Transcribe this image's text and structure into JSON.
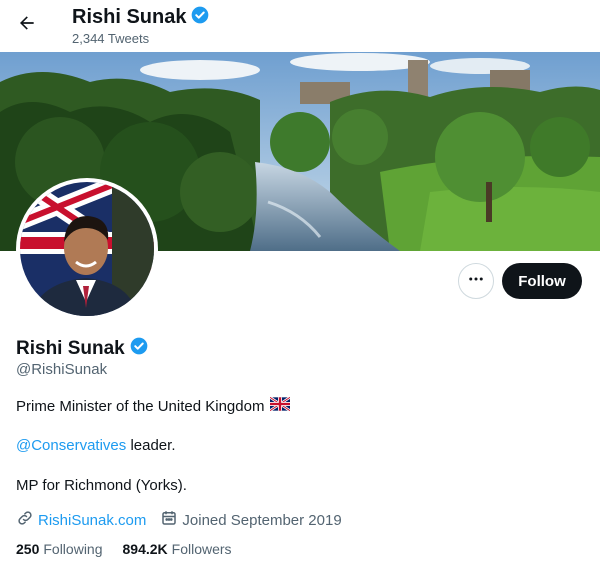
{
  "header": {
    "name": "Rishi Sunak",
    "tweet_count": "2,344 Tweets"
  },
  "actions": {
    "follow_label": "Follow"
  },
  "profile": {
    "name": "Rishi Sunak",
    "handle": "@RishiSunak",
    "bio_line1": "Prime Minister of the United Kingdom",
    "bio_mention": "@Conservatives",
    "bio_line2_rest": " leader.",
    "bio_line3": "MP for Richmond (Yorks).",
    "website": "RishiSunak.com",
    "joined": "Joined September 2019"
  },
  "stats": {
    "following_count": "250",
    "following_label": "Following",
    "followers_count": "894.2K",
    "followers_label": "Followers"
  },
  "colors": {
    "verified": "#1d9bf0",
    "link": "#1d9bf0",
    "follow_bg": "#0f1419"
  }
}
